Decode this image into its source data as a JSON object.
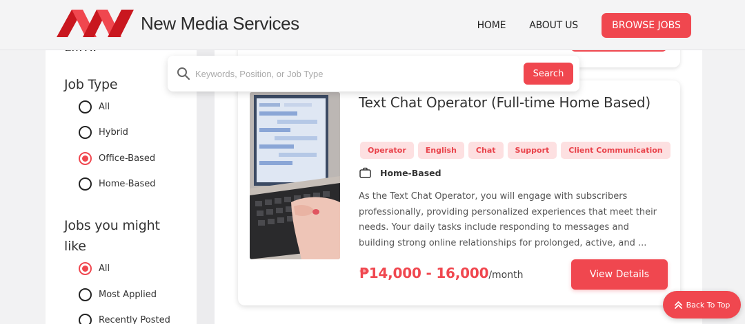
{
  "brand": {
    "name": "New Media Services",
    "accent_color": "#f0474f"
  },
  "nav": {
    "items": [
      "HOME",
      "ABOUT US"
    ],
    "cta": "BROWSE JOBS"
  },
  "search": {
    "placeholder": "Keywords, Position, or Job Type",
    "value": "",
    "button": "Search"
  },
  "filter": {
    "heading_cut": "Filter",
    "job_type": {
      "title": "Job Type",
      "options": [
        "All",
        "Hybrid",
        "Office-Based",
        "Home-Based"
      ],
      "selected": "Office-Based"
    },
    "jobs_you_might_like": {
      "title": "Jobs you might like",
      "options": [
        "All",
        "Most Applied",
        "Recently Posted"
      ],
      "selected": "All"
    }
  },
  "job": {
    "title": "Text Chat Operator (Full-time Home Based)",
    "tags": [
      "Operator",
      "English",
      "Chat",
      "Support",
      "Client Communication"
    ],
    "job_type": "Home-Based",
    "job_type_icon": "briefcase-icon",
    "description": "As the Text Chat Operator, you will engage with subscribers professionally, providing personalized experiences that meet their needs. Your daily tasks include responding to messages and building strong online relationships for prolonged, active, and ...",
    "salary": "₱14,000 - 16,000",
    "salary_unit": "/month",
    "cta": "View Details"
  },
  "back_to_top": "Back To Top"
}
